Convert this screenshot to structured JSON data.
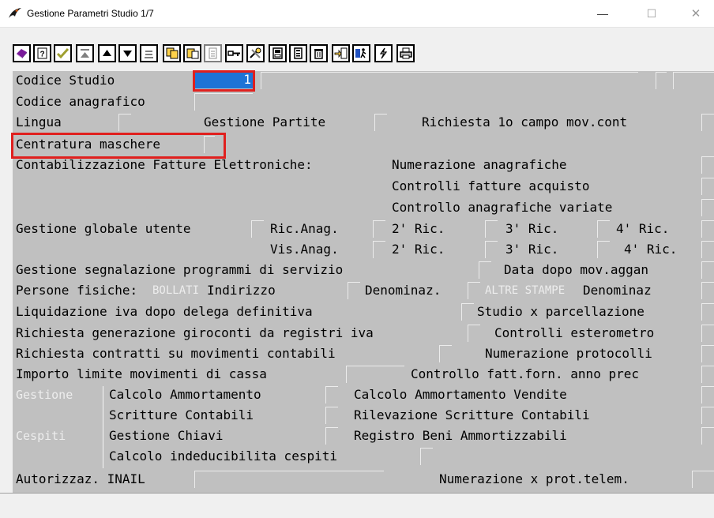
{
  "window": {
    "title": "Gestione Parametri Studio 1/7",
    "controls": {
      "minimize": "—",
      "maximize": "☐",
      "close": "✕"
    }
  },
  "toolbar": {
    "buttons": [
      "book-icon",
      "help-icon",
      "check-icon",
      "first-icon",
      "up-icon",
      "down-icon",
      "last-icon",
      "copy-icon",
      "paste-icon",
      "document-icon",
      "key-icon",
      "tools-icon",
      "save-icon",
      "calculator-icon",
      "trash-icon",
      "export-icon",
      "run-icon",
      "lightning-icon",
      "print-icon"
    ]
  },
  "form": {
    "codice_studio": {
      "label": "Codice Studio",
      "value": "1"
    },
    "codice_anagrafico": {
      "label": "Codice anagrafico"
    },
    "lingua": {
      "label": "Lingua"
    },
    "gestione_partite": {
      "label": "Gestione Partite"
    },
    "richiesta_primo_campo": {
      "label": "Richiesta 1o campo mov.cont"
    },
    "centratura_maschere": {
      "label": "Centratura maschere"
    },
    "contabilizzazione": {
      "label": "Contabilizzazione Fatture Elettroniche:"
    },
    "numerazione_anagrafiche": {
      "label": "Numerazione anagrafiche"
    },
    "controlli_fatture_acquisto": {
      "label": "Controlli fatture acquisto"
    },
    "controllo_anagrafiche_variate": {
      "label": "Controllo anagrafiche variate"
    },
    "gestione_globale_utente": {
      "label": "Gestione globale utente"
    },
    "ric_anag": {
      "label": "Ric.Anag."
    },
    "ric2": {
      "label": "2' Ric."
    },
    "ric3": {
      "label": "3' Ric."
    },
    "ric4": {
      "label": "4' Ric."
    },
    "vis_anag": {
      "label": "Vis.Anag."
    },
    "vis2": {
      "label": "2' Ric."
    },
    "vis3": {
      "label": "3' Ric."
    },
    "vis4": {
      "label": "4' Ric."
    },
    "gestione_segnalazione": {
      "label": "Gestione segnalazione programmi di servizio"
    },
    "data_dopo_mov": {
      "label": "Data dopo mov.aggan"
    },
    "persone_fisiche": {
      "label": "Persone fisiche:"
    },
    "bollati": {
      "label": "BOLLATI"
    },
    "indirizzo": {
      "label": "Indirizzo"
    },
    "denominaz": {
      "label": "Denominaz."
    },
    "altre_stampe": {
      "label": "ALTRE STAMPE"
    },
    "denominaz2": {
      "label": "Denominaz"
    },
    "liquidazione_iva": {
      "label": "Liquidazione iva dopo delega definitiva"
    },
    "studio_parcellazione": {
      "label": "Studio x parcellazione"
    },
    "richiesta_giroconti": {
      "label": "Richiesta generazione giroconti da registri iva"
    },
    "controlli_esterometro": {
      "label": "Controlli esterometro"
    },
    "richiesta_contratti": {
      "label": "Richiesta contratti su movimenti contabili"
    },
    "numerazione_protocolli": {
      "label": "Numerazione protocolli"
    },
    "importo_limite": {
      "label": "Importo limite movimenti di cassa"
    },
    "controllo_fatt_forn": {
      "label": "Controllo fatt.forn. anno prec"
    },
    "gestione_side": {
      "label": "Gestione"
    },
    "cespiti_side": {
      "label": "Cespiti"
    },
    "calcolo_ammortamento": {
      "label": "Calcolo Ammortamento"
    },
    "calcolo_ammortamento_vendite": {
      "label": "Calcolo Ammortamento Vendite"
    },
    "scritture_contabili": {
      "label": "Scritture Contabili"
    },
    "rilevazione_scritture": {
      "label": "Rilevazione Scritture Contabili"
    },
    "gestione_chiavi": {
      "label": "Gestione Chiavi"
    },
    "registro_beni": {
      "label": "Registro Beni Ammortizzabili"
    },
    "calcolo_indeducibilita": {
      "label": "Calcolo indeducibilita cespiti"
    },
    "autorizzaz_inail": {
      "label": "Autorizzaz. INAIL"
    },
    "numerazione_prot_telem": {
      "label": "Numerazione x prot.telem."
    }
  },
  "colors": {
    "form_background": "#c0c0c0",
    "selected_field": "#1e73d6",
    "highlight_border": "#e0201e",
    "chrome": "#f0f0f0"
  }
}
